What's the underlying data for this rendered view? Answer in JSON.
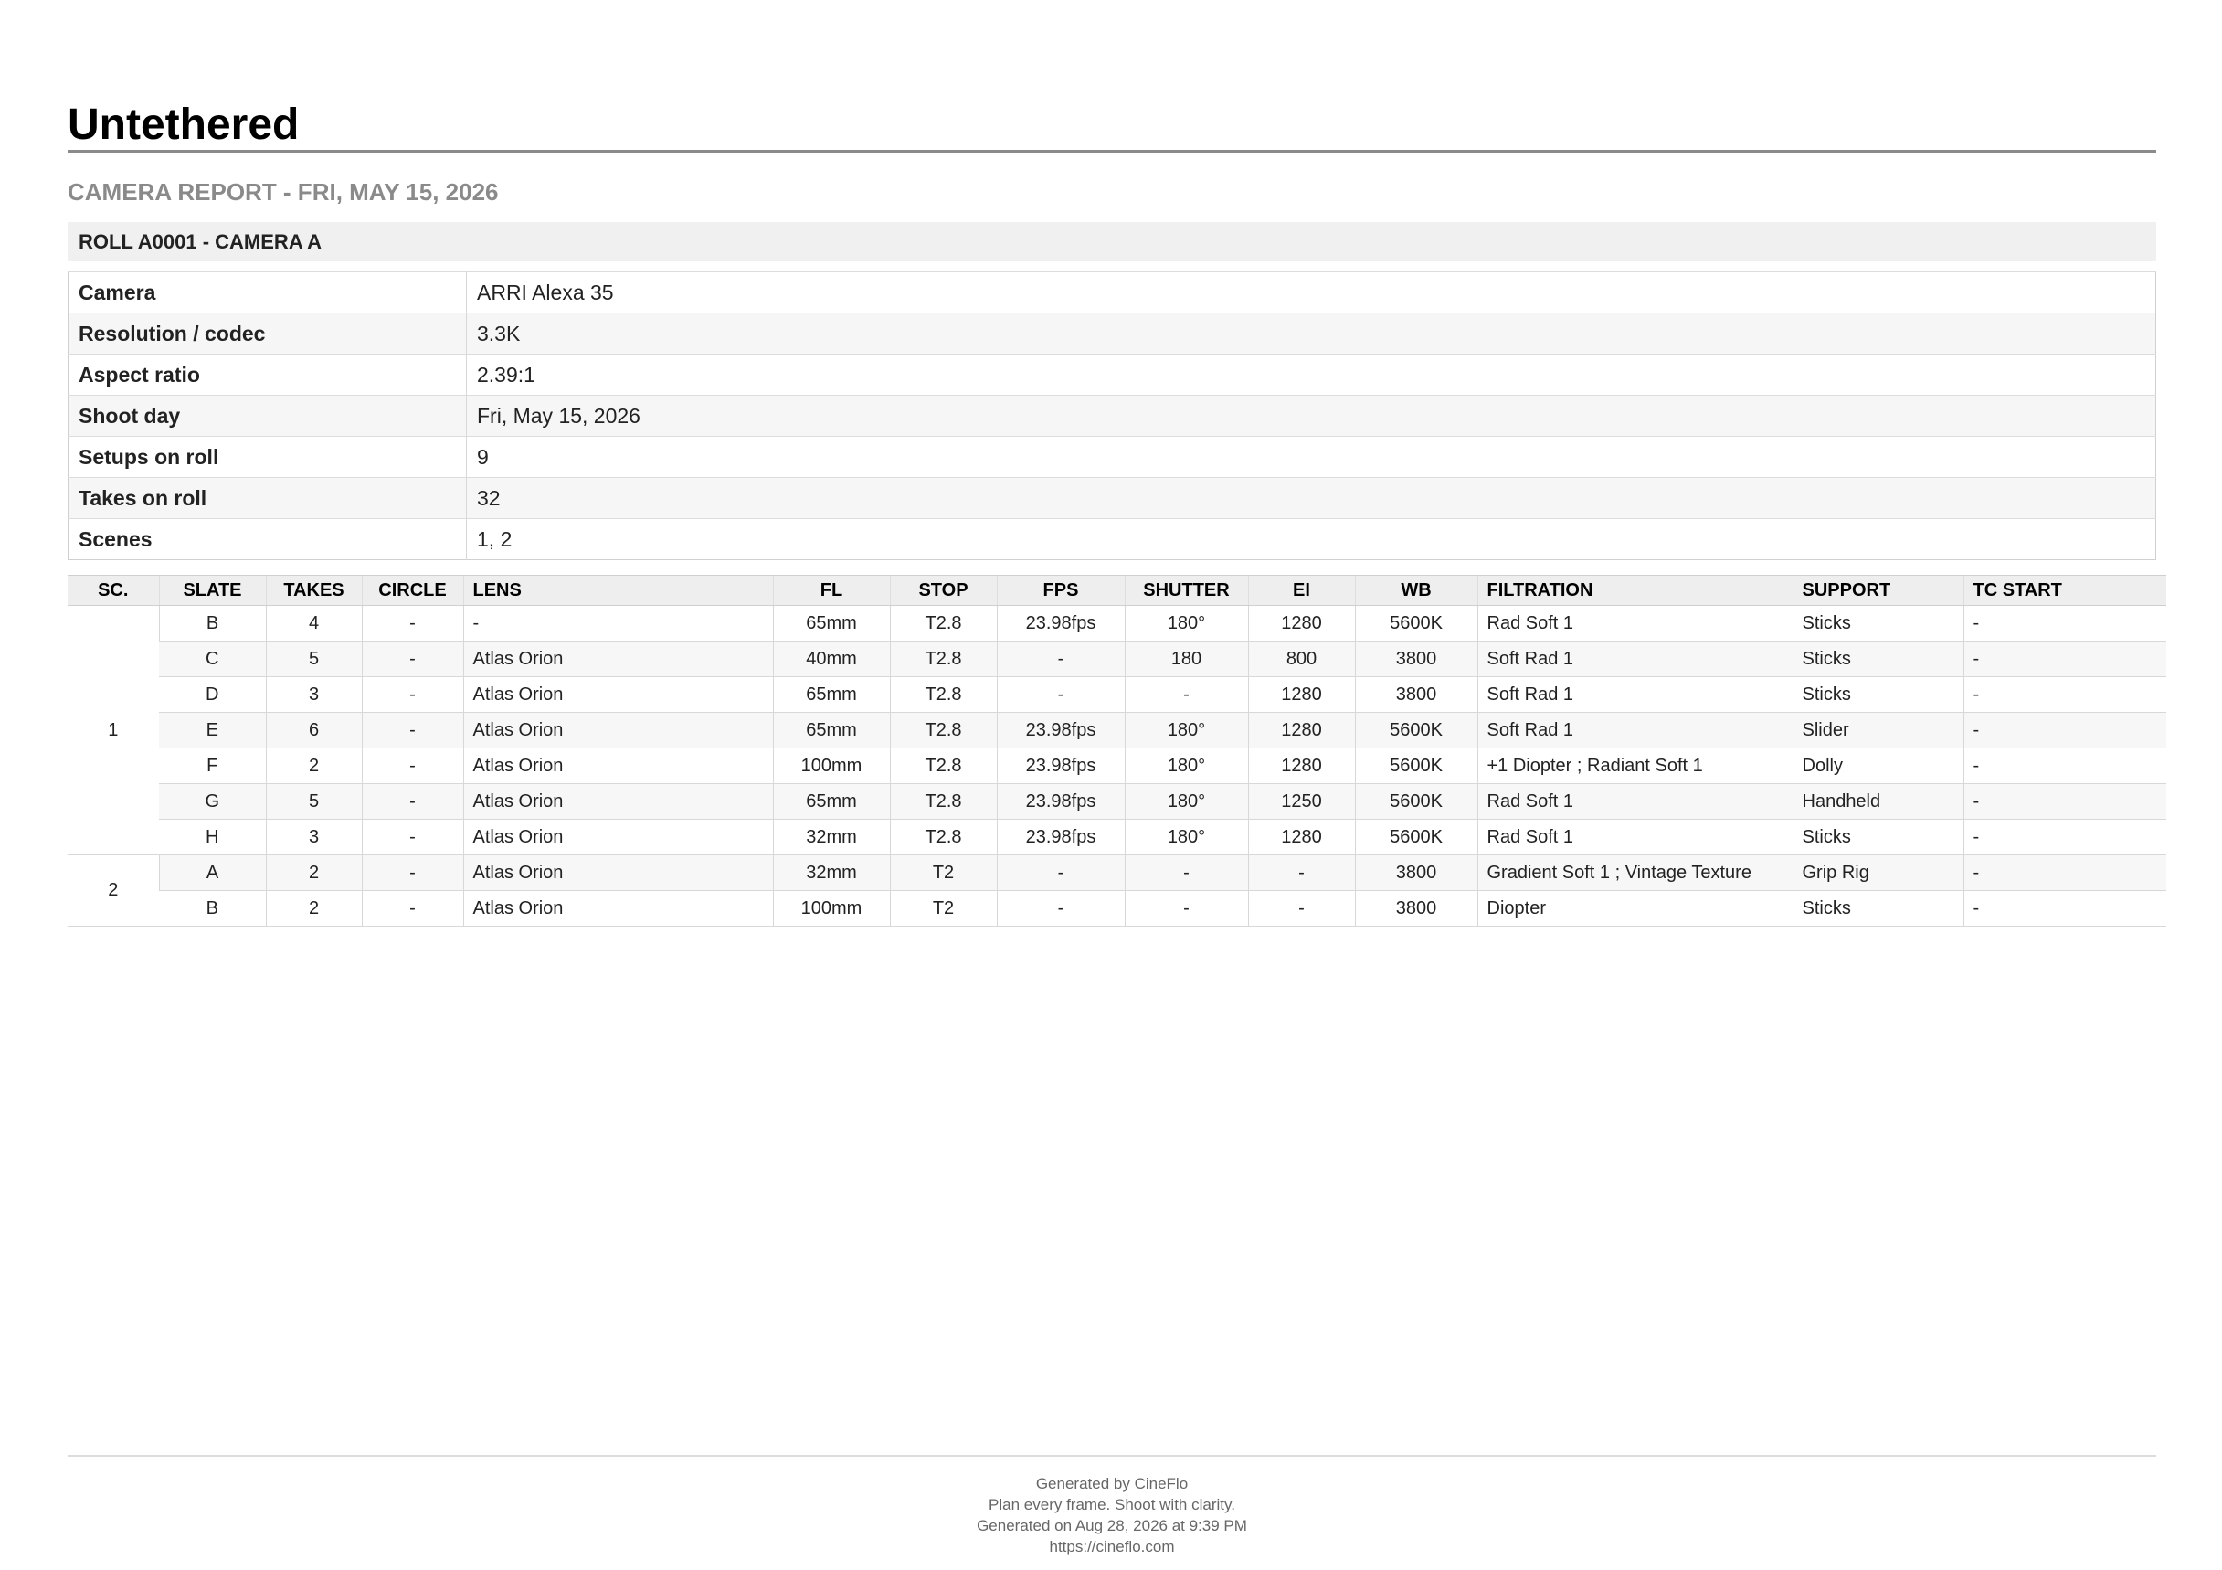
{
  "document": {
    "title": "Untethered",
    "report_title": "CAMERA REPORT - FRI, MAY 15, 2026",
    "roll_header": "ROLL A0001 - CAMERA A"
  },
  "info": [
    {
      "label": "Camera",
      "value": "ARRI Alexa 35"
    },
    {
      "label": "Resolution / codec",
      "value": "3.3K"
    },
    {
      "label": "Aspect ratio",
      "value": "2.39:1"
    },
    {
      "label": "Shoot day",
      "value": "Fri, May 15, 2026"
    },
    {
      "label": "Setups on roll",
      "value": "9"
    },
    {
      "label": "Takes on roll",
      "value": "32"
    },
    {
      "label": "Scenes",
      "value": "1, 2"
    }
  ],
  "table": {
    "headers": [
      "SC.",
      "SLATE",
      "TAKES",
      "CIRCLE",
      "LENS",
      "FL",
      "STOP",
      "FPS",
      "SHUTTER",
      "EI",
      "WB",
      "FILTRATION",
      "SUPPORT",
      "TC START"
    ],
    "scenes": [
      {
        "scene": "1",
        "rows": [
          [
            "B",
            "4",
            "-",
            "-",
            "65mm",
            "T2.8",
            "23.98fps",
            "180°",
            "1280",
            "5600K",
            "Rad Soft 1",
            "Sticks",
            "-"
          ],
          [
            "C",
            "5",
            "-",
            "Atlas Orion",
            "40mm",
            "T2.8",
            "-",
            "180",
            "800",
            "3800",
            "Soft Rad 1",
            "Sticks",
            "-"
          ],
          [
            "D",
            "3",
            "-",
            "Atlas Orion",
            "65mm",
            "T2.8",
            "-",
            "-",
            "1280",
            "3800",
            "Soft Rad 1",
            "Sticks",
            "-"
          ],
          [
            "E",
            "6",
            "-",
            "Atlas Orion",
            "65mm",
            "T2.8",
            "23.98fps",
            "180°",
            "1280",
            "5600K",
            "Soft Rad 1",
            "Slider",
            "-"
          ],
          [
            "F",
            "2",
            "-",
            "Atlas Orion",
            "100mm",
            "T2.8",
            "23.98fps",
            "180°",
            "1280",
            "5600K",
            "+1 Diopter ; Radiant Soft 1",
            "Dolly",
            "-"
          ],
          [
            "G",
            "5",
            "-",
            "Atlas Orion",
            "65mm",
            "T2.8",
            "23.98fps",
            "180°",
            "1250",
            "5600K",
            "Rad Soft 1",
            "Handheld",
            "-"
          ],
          [
            "H",
            "3",
            "-",
            "Atlas Orion",
            "32mm",
            "T2.8",
            "23.98fps",
            "180°",
            "1280",
            "5600K",
            "Rad Soft 1",
            "Sticks",
            "-"
          ]
        ]
      },
      {
        "scene": "2",
        "rows": [
          [
            "A",
            "2",
            "-",
            "Atlas Orion",
            "32mm",
            "T2",
            "-",
            "-",
            "-",
            "3800",
            "Gradient Soft 1 ; Vintage Texture",
            "Grip Rig",
            "-"
          ],
          [
            "B",
            "2",
            "-",
            "Atlas Orion",
            "100mm",
            "T2",
            "-",
            "-",
            "-",
            "3800",
            "Diopter",
            "Sticks",
            "-"
          ]
        ]
      }
    ]
  },
  "footer": {
    "generated_by": "Generated by CineFlo",
    "tagline": "Plan every frame. Shoot with clarity.",
    "generated_on": "Generated on Aug 28, 2026 at 9:39 PM",
    "url": "https://cineflo.com"
  }
}
